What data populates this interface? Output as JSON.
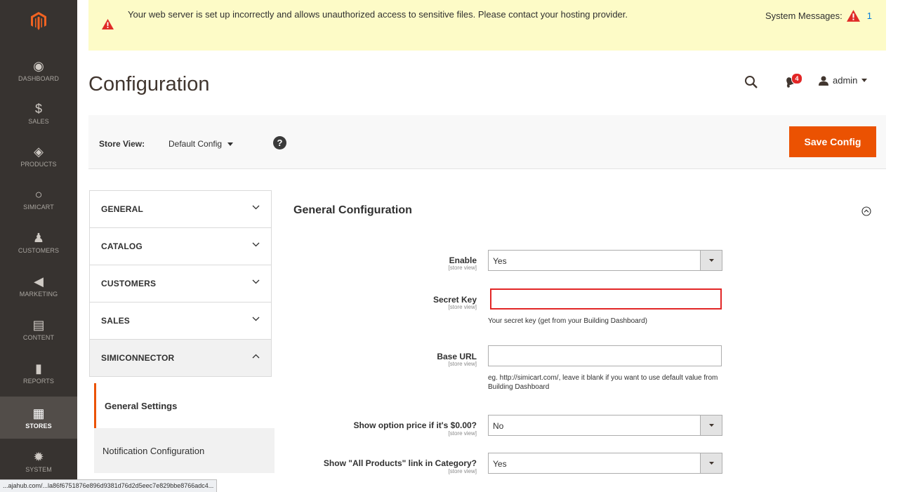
{
  "sidebar": {
    "items": [
      {
        "label": "DASHBOARD",
        "icon": "dashboard-gauge-icon",
        "glyph": "◉"
      },
      {
        "label": "SALES",
        "icon": "dollar-icon",
        "glyph": "$"
      },
      {
        "label": "PRODUCTS",
        "icon": "cube-icon",
        "glyph": "◈"
      },
      {
        "label": "SIMICART",
        "icon": "circle-icon",
        "glyph": "○"
      },
      {
        "label": "CUSTOMERS",
        "icon": "person-icon",
        "glyph": "♟"
      },
      {
        "label": "MARKETING",
        "icon": "megaphone-icon",
        "glyph": "◀"
      },
      {
        "label": "CONTENT",
        "icon": "content-page-icon",
        "glyph": "▤"
      },
      {
        "label": "REPORTS",
        "icon": "bar-chart-icon",
        "glyph": "▮"
      },
      {
        "label": "STORES",
        "icon": "store-icon",
        "glyph": "▦"
      },
      {
        "label": "SYSTEM",
        "icon": "gear-icon",
        "glyph": "✹"
      }
    ]
  },
  "message": {
    "text": "Your web server is set up incorrectly and allows unauthorized access to sensitive files. Please contact your hosting provider.",
    "system_label": "System Messages:",
    "system_count": "1"
  },
  "header": {
    "title": "Configuration",
    "notifications": "4",
    "user": "admin"
  },
  "storebar": {
    "label": "Store View:",
    "value": "Default Config",
    "help": "?",
    "save": "Save Config"
  },
  "tabs": [
    {
      "label": "GENERAL"
    },
    {
      "label": "CATALOG"
    },
    {
      "label": "CUSTOMERS"
    },
    {
      "label": "SALES"
    },
    {
      "label": "SIMICONNECTOR"
    }
  ],
  "subitems": [
    {
      "label": "General Settings"
    },
    {
      "label": "Notification Configuration"
    }
  ],
  "main": {
    "section_title": "General Configuration",
    "scope": "[store view]",
    "fields": {
      "enable": {
        "label": "Enable",
        "value": "Yes"
      },
      "secret_key": {
        "label": "Secret Key",
        "value": "",
        "note": "Your secret key (get from your Building Dashboard)"
      },
      "base_url": {
        "label": "Base URL",
        "value": "",
        "note": "eg. http://simicart.com/, leave it blank if you want to use default value from Building Dashboard"
      },
      "show_price": {
        "label": "Show option price if it's $0.00?",
        "value": "No"
      },
      "show_all": {
        "label": "Show \"All Products\" link in Category?",
        "value": "Yes"
      }
    }
  },
  "status_url": "...ajahub.com/...la86f6751876e896d9381d76d2d5eec7e829bbe8766adc4..."
}
